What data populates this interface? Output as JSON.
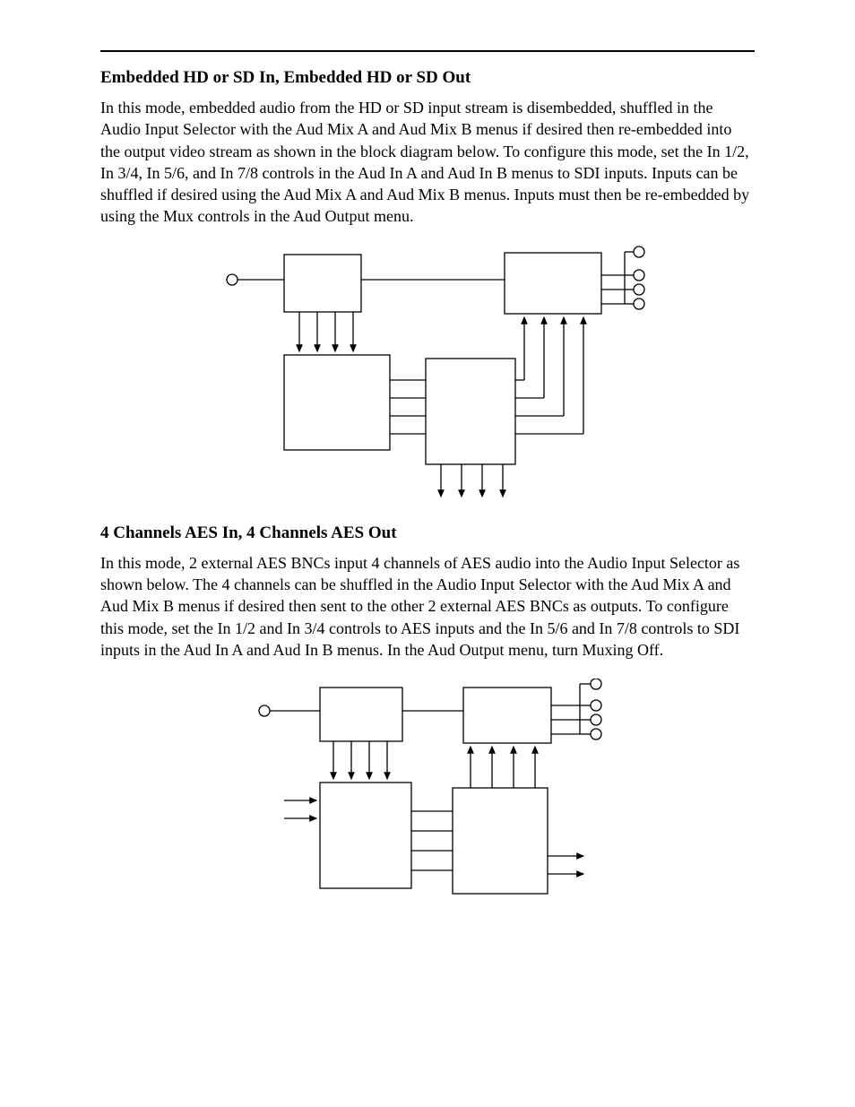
{
  "section1": {
    "title": "Embedded HD or SD In, Embedded HD or SD Out",
    "body": "In this mode, embedded audio from the HD or SD input stream is disembedded, shuffled in the Audio Input Selector with the Aud Mix A and Aud Mix B menus if desired then re-embedded into the output video stream as shown in the block diagram below. To configure this mode, set the In 1/2, In 3/4, In 5/6, and In 7/8 controls in the Aud In A and Aud In B menus to SDI inputs. Inputs can be shuffled if desired using the Aud Mix A and Aud Mix B menus. Inputs must then be re-embedded by using the Mux controls in the Aud Output menu."
  },
  "section2": {
    "title": "4 Channels AES In, 4 Channels AES Out",
    "body": "In this mode, 2 external AES BNCs input 4 channels of AES audio into the Audio Input Selector as shown below. The 4 channels can be shuffled in the Audio Input Selector with the Aud Mix A and Aud Mix B menus if desired then sent to the other 2 external AES BNCs as outputs. To configure this mode, set the In 1/2 and In 3/4 controls to AES inputs and the In 5/6 and In 7/8 controls to SDI inputs in the Aud In A and Aud In B menus. In the Aud Output menu, turn Muxing Off."
  }
}
